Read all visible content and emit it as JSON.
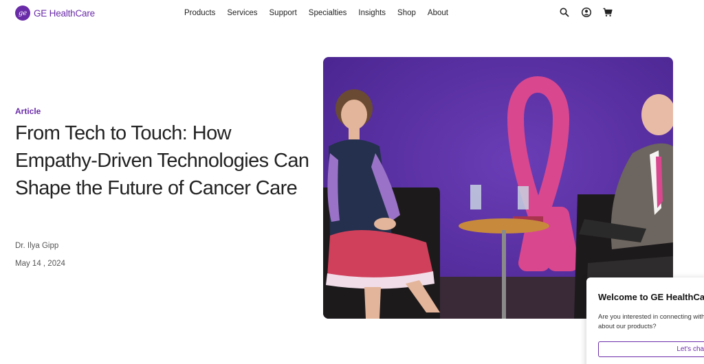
{
  "brand": {
    "name": "GE HealthCare",
    "mark": "ge",
    "color": "#6a2ba8"
  },
  "nav": {
    "items": [
      {
        "label": "Products"
      },
      {
        "label": "Services"
      },
      {
        "label": "Support"
      },
      {
        "label": "Specialties"
      },
      {
        "label": "Insights"
      },
      {
        "label": "Shop"
      },
      {
        "label": "About"
      }
    ]
  },
  "header_icons": [
    "search-icon",
    "account-icon",
    "cart-icon"
  ],
  "article": {
    "tag": "Article",
    "title": "From Tech to Touch: How Empathy-Driven Technologies Can Shape the Future of Cancer Care",
    "author": "Dr. Ilya Gipp",
    "date": "May 14 , 2024"
  },
  "hero": {
    "image": "panel-discussion-photo",
    "background_color": "#5e36a8",
    "ribbon_color": "#d9478f"
  },
  "chat": {
    "title": "Welcome to GE HealthCare",
    "body": "Are you interested in connecting with us about our products?",
    "button": "Let's chat!"
  }
}
